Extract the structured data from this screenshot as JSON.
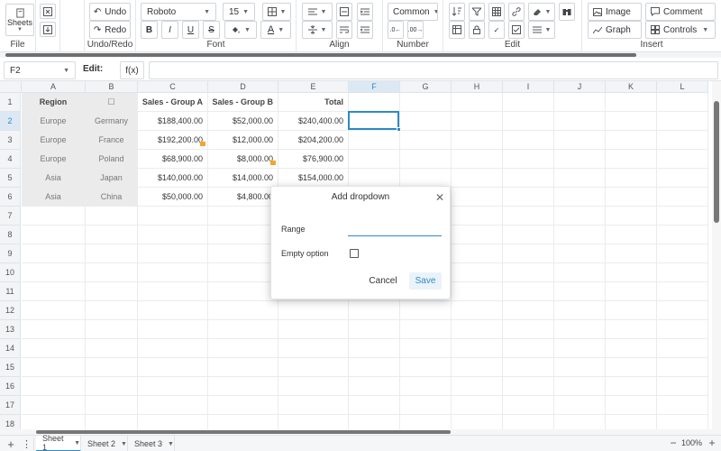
{
  "toolbar": {
    "file": {
      "sheets_label": "Sheets",
      "group_label": "File"
    },
    "undo": {
      "undo_label": "Undo",
      "redo_label": "Redo",
      "group_label": "Undo/Redo"
    },
    "font": {
      "family": "Roboto",
      "size": "15",
      "bold": "B",
      "italic": "I",
      "underline": "U",
      "strike": "S",
      "group_label": "Font"
    },
    "align": {
      "group_label": "Align"
    },
    "number": {
      "format": "Common",
      "group_label": "Number"
    },
    "edit": {
      "group_label": "Edit"
    },
    "insert": {
      "image_label": "Image",
      "comment_label": "Comment",
      "graph_label": "Graph",
      "controls_label": "Controls",
      "group_label": "Insert"
    }
  },
  "formula_bar": {
    "cell_ref": "F2",
    "edit_label": "Edit:",
    "fx_label": "f(x)",
    "value": ""
  },
  "grid": {
    "columns": [
      "A",
      "B",
      "C",
      "D",
      "E",
      "F",
      "G",
      "H",
      "I",
      "J",
      "K",
      "L"
    ],
    "rows": [
      "1",
      "2",
      "3",
      "4",
      "5",
      "6",
      "7",
      "8",
      "9",
      "10",
      "11",
      "12",
      "13",
      "14",
      "15",
      "16",
      "17",
      "18"
    ],
    "selected_cell": "F2",
    "header_row": {
      "region": "Region",
      "checkbox": "☐",
      "sales_a": "Sales - Group A",
      "sales_b": "Sales - Group B",
      "total": "Total"
    },
    "data": [
      {
        "region": "Europe",
        "country": "Germany",
        "sales_a": "$188,400.00",
        "sales_b": "$52,000.00",
        "total": "$240,400.00"
      },
      {
        "region": "Europe",
        "country": "France",
        "sales_a": "$192,200.00",
        "sales_b": "$12,000.00",
        "total": "$204,200.00"
      },
      {
        "region": "Europe",
        "country": "Poland",
        "sales_a": "$68,900.00",
        "sales_b": "$8,000.00",
        "total": "$76,900.00"
      },
      {
        "region": "Asia",
        "country": "Japan",
        "sales_a": "$140,000.00",
        "sales_b": "$14,000.00",
        "total": "$154,000.00"
      },
      {
        "region": "Asia",
        "country": "China",
        "sales_a": "$50,000.00",
        "sales_b": "$4,800.00",
        "total": ""
      }
    ]
  },
  "dialog": {
    "title": "Add dropdown",
    "range_label": "Range",
    "range_value": "",
    "empty_option_label": "Empty option",
    "cancel_label": "Cancel",
    "save_label": "Save"
  },
  "sheets": {
    "tabs": [
      "Sheet 1",
      "Sheet 2",
      "Sheet 3"
    ],
    "active": "Sheet 1",
    "zoom": "100%"
  },
  "colors": {
    "accent": "#2f89c5",
    "note_marker": "#f4a62a",
    "dropdown_fill": "#ebebeb"
  }
}
